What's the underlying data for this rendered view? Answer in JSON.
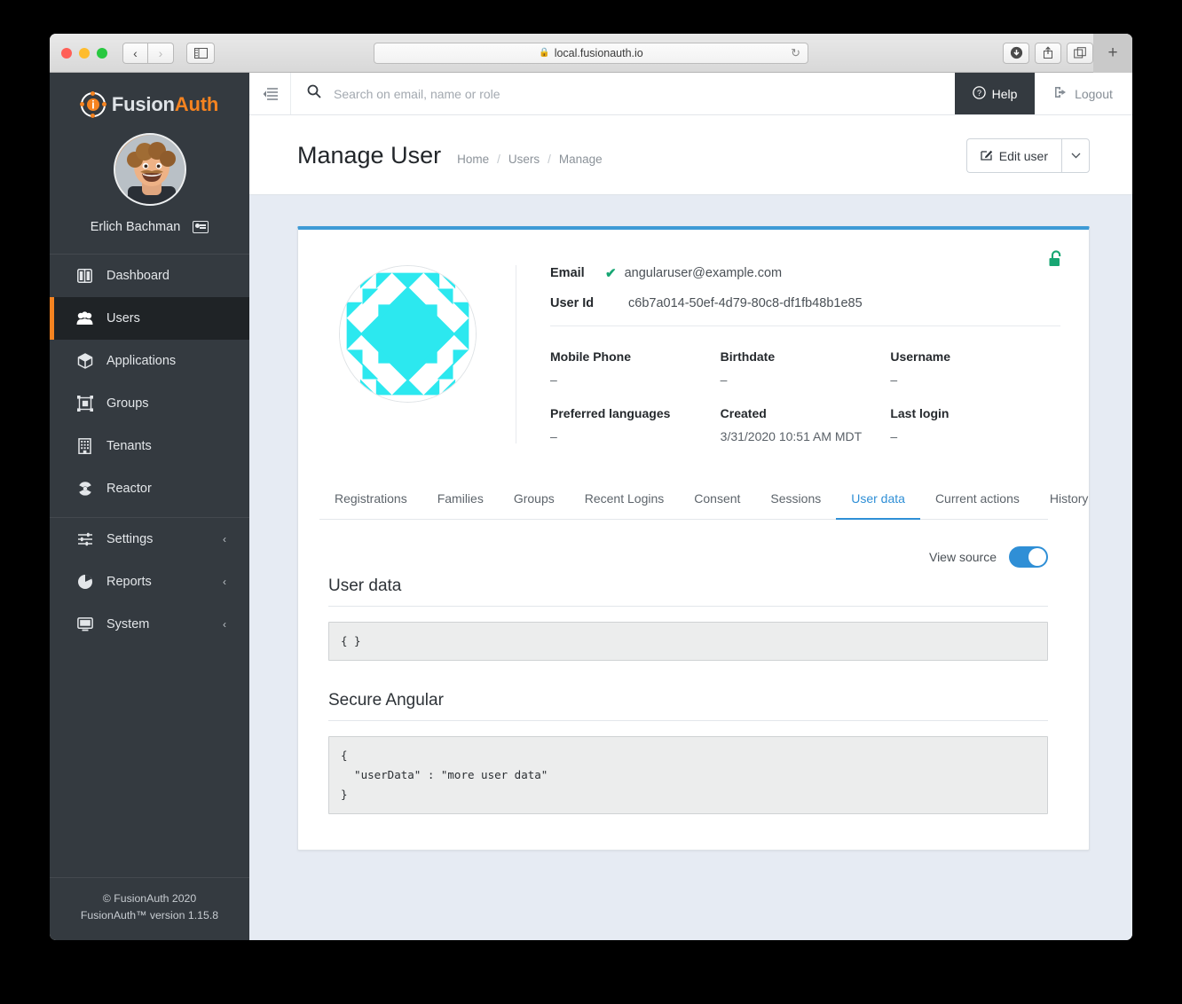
{
  "browser": {
    "url": "local.fusionauth.io",
    "lock_icon": "lock-icon",
    "reload_icon": "reload-icon",
    "back_icon": "chevron-left-icon",
    "forward_icon": "chevron-right-icon",
    "sidebar_icon": "sidebar-toggle-icon",
    "download_icon": "download-icon",
    "share_icon": "share-icon",
    "tabs_icon": "tab-overview-icon",
    "new_tab_label": "+"
  },
  "sidebar": {
    "brand": {
      "first": "Fusion",
      "second": "Auth",
      "mark_letter": "i"
    },
    "user_name": "Erlich Bachman",
    "badge_icon": "id-card-icon",
    "items": [
      {
        "label": "Dashboard",
        "icon": "dashboard-icon",
        "active": false,
        "chevron": ""
      },
      {
        "label": "Users",
        "icon": "users-icon",
        "active": true,
        "chevron": ""
      },
      {
        "label": "Applications",
        "icon": "box-icon",
        "active": false,
        "chevron": ""
      },
      {
        "label": "Groups",
        "icon": "groups-icon",
        "active": false,
        "chevron": ""
      },
      {
        "label": "Tenants",
        "icon": "building-icon",
        "active": false,
        "chevron": ""
      },
      {
        "label": "Reactor",
        "icon": "radiation-icon",
        "active": false,
        "chevron": ""
      }
    ],
    "items2": [
      {
        "label": "Settings",
        "icon": "sliders-icon",
        "chevron": "‹"
      },
      {
        "label": "Reports",
        "icon": "pie-chart-icon",
        "chevron": "‹"
      },
      {
        "label": "System",
        "icon": "monitor-icon",
        "chevron": "‹"
      }
    ],
    "footer_line1": "© FusionAuth 2020",
    "footer_line2": "FusionAuth™ version 1.15.8"
  },
  "topbar": {
    "collapse_icon": "collapse-menu-icon",
    "search_icon": "search-icon",
    "search_placeholder": "Search on email, name or role",
    "search_value": "",
    "help_label": "Help",
    "help_icon": "question-circle-icon",
    "logout_label": "Logout",
    "logout_icon": "sign-out-icon"
  },
  "page": {
    "title": "Manage User",
    "breadcrumbs": [
      "Home",
      "Users",
      "Manage"
    ],
    "separator": "/",
    "edit_button_label": "Edit user",
    "edit_button_icon": "pencil-square-icon",
    "caret_icon": "chevron-down-icon"
  },
  "card": {
    "lock_icon": "unlock-icon",
    "lock_color": "#17a673",
    "accent_color": "#3e9ad5",
    "identicon": "user-identicon",
    "identicon_color": "#2ce8ef",
    "email_label": "Email",
    "email_value": "angularuser@example.com",
    "email_verified_icon": "check-icon",
    "userid_label": "User Id",
    "userid_value": "c6b7a014-50ef-4d79-80c8-df1fb48b1e85",
    "fields": [
      {
        "label": "Mobile Phone",
        "value": "–"
      },
      {
        "label": "Birthdate",
        "value": "–"
      },
      {
        "label": "Username",
        "value": "–"
      },
      {
        "label": "Preferred languages",
        "value": "–"
      },
      {
        "label": "Created",
        "value": "3/31/2020 10:51 AM MDT"
      },
      {
        "label": "Last login",
        "value": "–"
      }
    ]
  },
  "tabs": [
    {
      "label": "Registrations",
      "active": false
    },
    {
      "label": "Families",
      "active": false
    },
    {
      "label": "Groups",
      "active": false
    },
    {
      "label": "Recent Logins",
      "active": false
    },
    {
      "label": "Consent",
      "active": false
    },
    {
      "label": "Sessions",
      "active": false
    },
    {
      "label": "User data",
      "active": true
    },
    {
      "label": "Current actions",
      "active": false
    },
    {
      "label": "History",
      "active": false
    }
  ],
  "userdata_panel": {
    "view_source_label": "View source",
    "view_source_on": true,
    "section1_title": "User data",
    "section1_code": "{ }",
    "section2_title": "Secure Angular",
    "section2_code": "{\n  \"userData\" : \"more user data\"\n}"
  }
}
